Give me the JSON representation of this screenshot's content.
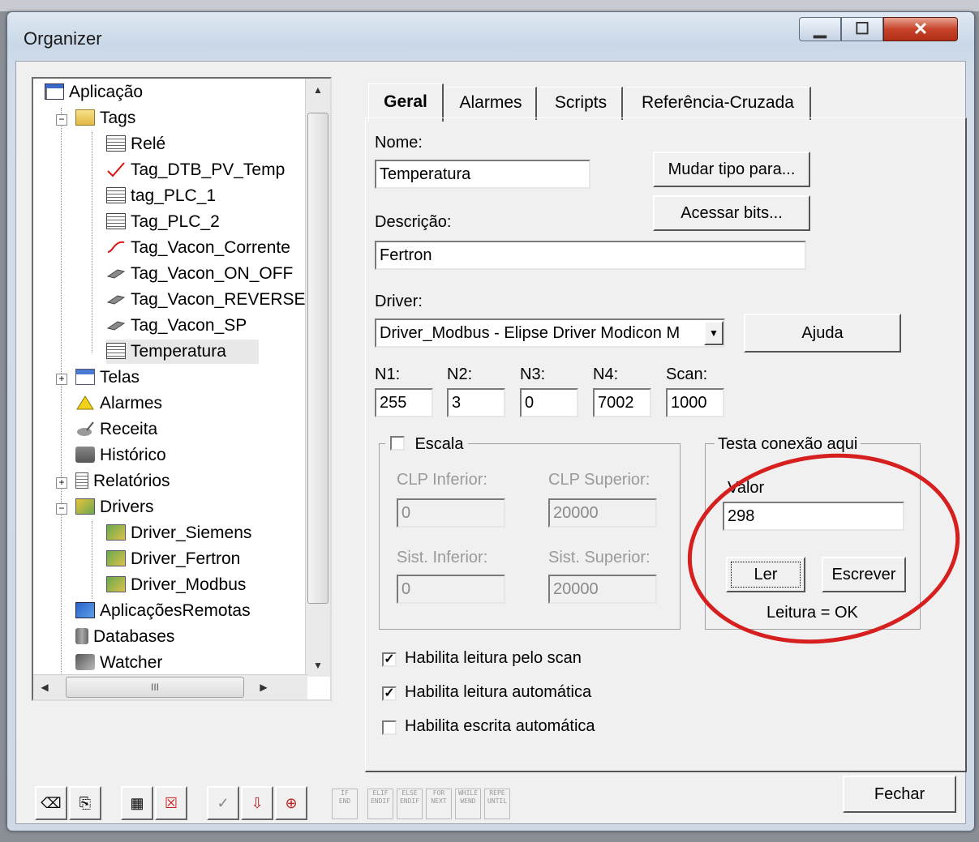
{
  "window": {
    "title": "Organizer"
  },
  "tree": {
    "items": [
      {
        "label": "Aplicação",
        "icon": "application-icon"
      },
      {
        "label": "Tags",
        "icon": "folder-icon"
      },
      {
        "label": "Relé",
        "icon": "tag-icon"
      },
      {
        "label": "Tag_DTB_PV_Temp",
        "icon": "tag-curve-icon"
      },
      {
        "label": "tag_PLC_1",
        "icon": "tag-icon"
      },
      {
        "label": "Tag_PLC_2",
        "icon": "tag-icon"
      },
      {
        "label": "Tag_Vacon_Corrente",
        "icon": "tag-curve-icon"
      },
      {
        "label": "Tag_Vacon_ON_OFF",
        "icon": "tag-block-icon"
      },
      {
        "label": "Tag_Vacon_REVERSE",
        "icon": "tag-block-icon"
      },
      {
        "label": "Tag_Vacon_SP",
        "icon": "tag-block-icon"
      },
      {
        "label": "Temperatura",
        "icon": "tag-icon"
      },
      {
        "label": "Telas",
        "icon": "screens-icon"
      },
      {
        "label": "Alarmes",
        "icon": "alarm-icon"
      },
      {
        "label": "Receita",
        "icon": "recipe-icon"
      },
      {
        "label": "Histórico",
        "icon": "history-icon"
      },
      {
        "label": "Relatórios",
        "icon": "reports-icon"
      },
      {
        "label": "Drivers",
        "icon": "drivers-icon"
      },
      {
        "label": "Driver_Siemens",
        "icon": "driver-icon"
      },
      {
        "label": "Driver_Fertron",
        "icon": "driver-icon"
      },
      {
        "label": "Driver_Modbus",
        "icon": "driver-icon"
      },
      {
        "label": "AplicaçõesRemotas",
        "icon": "remote-icon"
      },
      {
        "label": "Databases",
        "icon": "database-icon"
      },
      {
        "label": "Watcher",
        "icon": "watcher-icon"
      }
    ],
    "scroll_marker": "III"
  },
  "tabs": [
    "Geral",
    "Alarmes",
    "Scripts",
    "Referência-Cruzada"
  ],
  "form": {
    "nome_label": "Nome:",
    "nome_value": "Temperatura",
    "mudar_button": "Mudar tipo para...",
    "acessar_button": "Acessar bits...",
    "descricao_label": "Descrição:",
    "descricao_value": "Fertron",
    "driver_label": "Driver:",
    "driver_value": "Driver_Modbus - Elipse Driver Modicon M",
    "ajuda_button": "Ajuda",
    "n1_label": "N1:",
    "n1_value": "255",
    "n2_label": "N2:",
    "n2_value": "3",
    "n3_label": "N3:",
    "n3_value": "0",
    "n4_label": "N4:",
    "n4_value": "7002",
    "scan_label": "Scan:",
    "scan_value": "1000"
  },
  "escala": {
    "label": "Escala",
    "clp_inferior_label": "CLP Inferior:",
    "clp_inferior_value": "0",
    "clp_superior_label": "CLP Superior:",
    "clp_superior_value": "20000",
    "sist_inferior_label": "Sist. Inferior:",
    "sist_inferior_value": "0",
    "sist_superior_label": "Sist. Superior:",
    "sist_superior_value": "20000"
  },
  "testa": {
    "group_label": "Testa conexão aqui",
    "valor_label": "Valor",
    "valor_value": "298",
    "ler_button": "Ler",
    "escrever_button": "Escrever",
    "status": "Leitura = OK"
  },
  "checks": [
    {
      "label": "Habilita leitura pelo scan",
      "checked": true
    },
    {
      "label": "Habilita leitura automática",
      "checked": true
    },
    {
      "label": "Habilita escrita automática",
      "checked": false
    }
  ],
  "toolbar": {
    "script_keywords": [
      [
        "IF",
        "END"
      ],
      [
        "ELIF",
        "ENDIF"
      ],
      [
        "ELSE",
        "ENDIF"
      ],
      [
        "FOR",
        "NEXT"
      ],
      [
        "WHILE",
        "WEND"
      ],
      [
        "REPE",
        "UNTIL"
      ]
    ],
    "fechar_button": "Fechar"
  },
  "annotation_color": "#d61f1f"
}
